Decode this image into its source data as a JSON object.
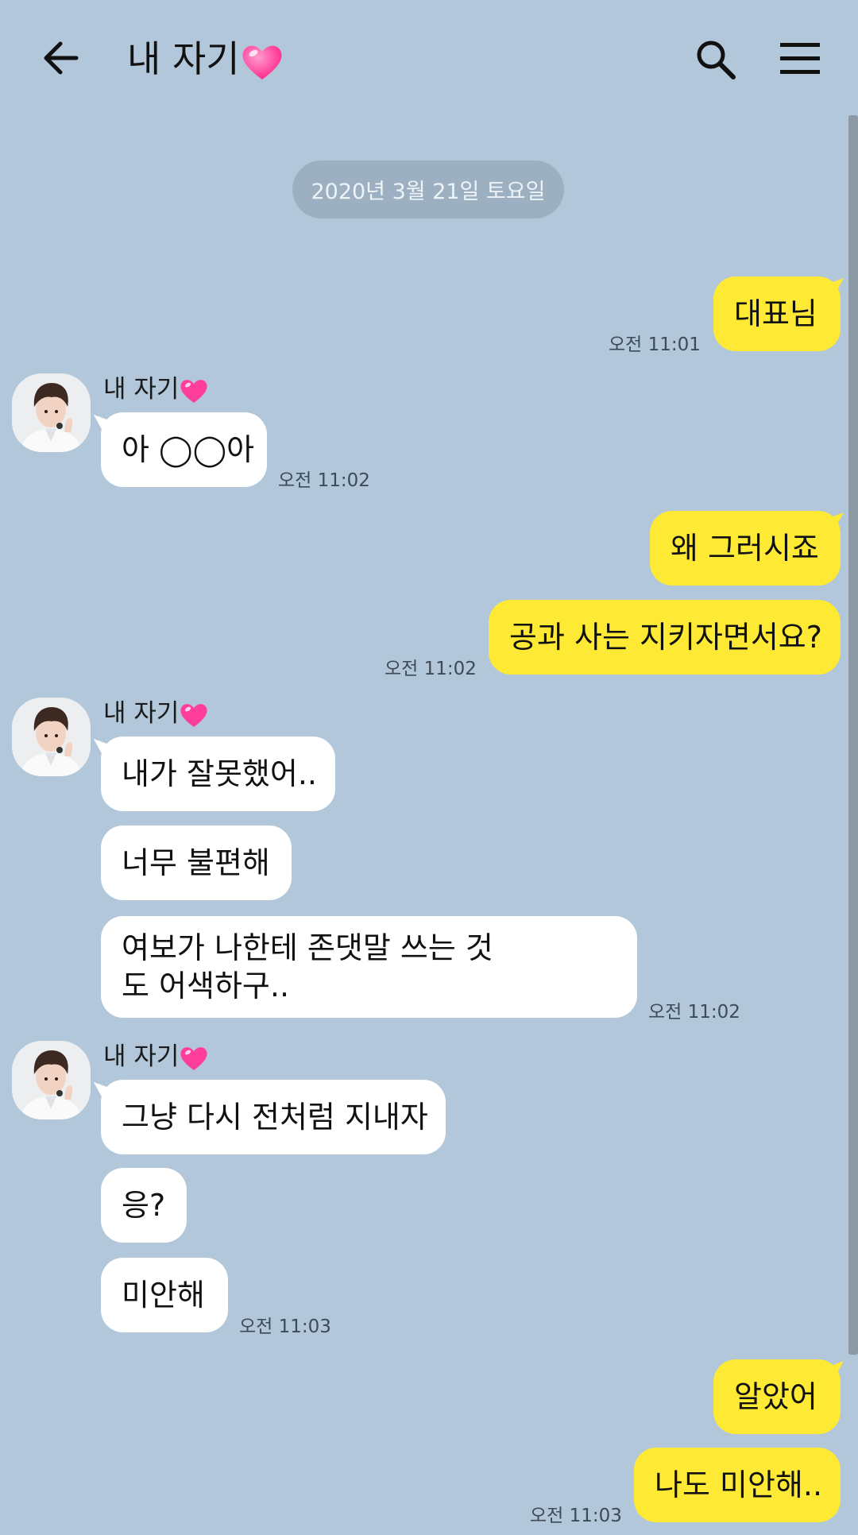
{
  "header": {
    "title": "내 자기",
    "back_icon": "arrow-left-icon",
    "search_icon": "search-icon",
    "menu_icon": "hamburger-menu-icon",
    "heart_icon": "pink-heart-icon"
  },
  "date_divider": "2020년 3월 21일 토요일",
  "sender_name": "내 자기",
  "messages": [
    {
      "from": "me",
      "text": "대표님",
      "time": "오전 11:01"
    },
    {
      "from": "them",
      "text": "아 ◯◯아",
      "time": "오전 11:02"
    },
    {
      "from": "me",
      "text": "왜 그러시죠"
    },
    {
      "from": "me",
      "text": "공과 사는 지키자면서요?",
      "time": "오전 11:02"
    },
    {
      "from": "them",
      "text": "내가 잘못했어.."
    },
    {
      "from": "them",
      "text": "너무 불편해"
    },
    {
      "from": "them",
      "text": "여보가 나한테 존댓말 쓰는 것도 어색하구..",
      "time": "오전 11:02"
    },
    {
      "from": "them",
      "text": "그냥 다시 전처럼 지내자"
    },
    {
      "from": "them",
      "text": "응?"
    },
    {
      "from": "them",
      "text": "미안해",
      "time": "오전 11:03"
    },
    {
      "from": "me",
      "text": "알았어"
    },
    {
      "from": "me",
      "text": "나도 미안해..",
      "time": "오전 11:03"
    }
  ],
  "colors": {
    "background": "#b2c7da",
    "my_bubble": "#fee935",
    "their_bubble": "#ffffff",
    "date_pill": "#9db0c2",
    "heart": "#ff3d9a"
  }
}
